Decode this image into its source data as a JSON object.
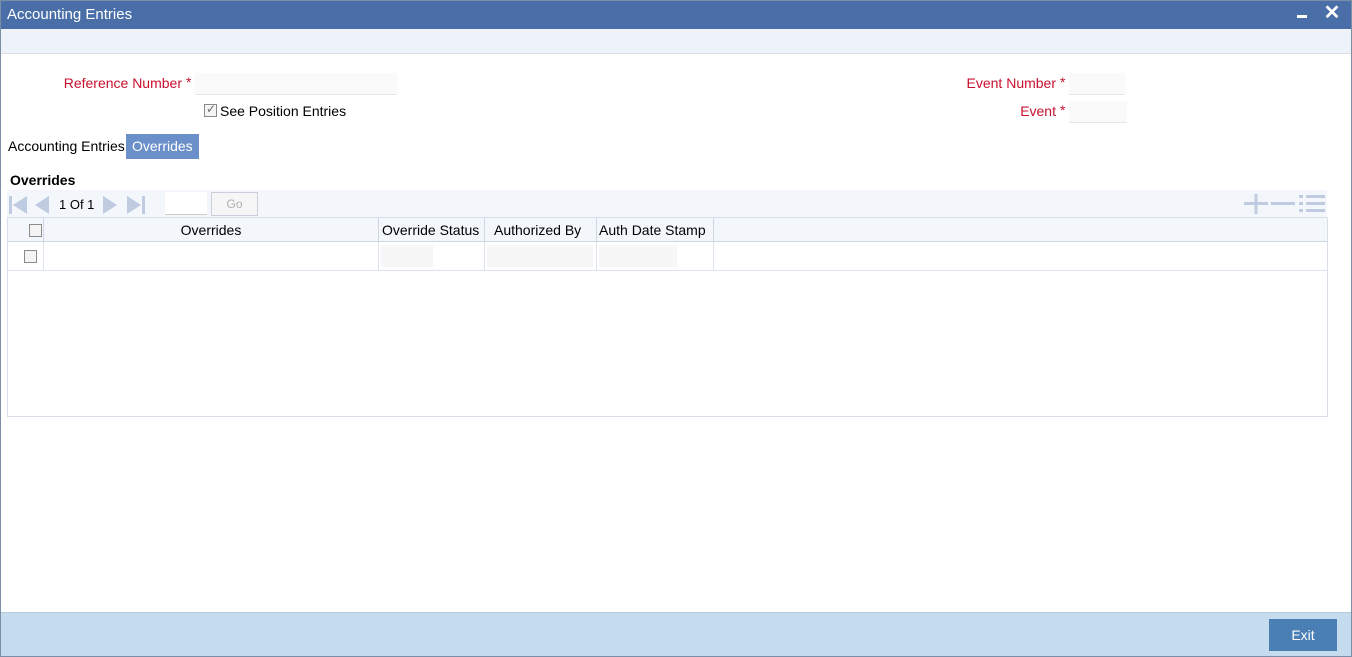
{
  "window": {
    "title": "Accounting Entries"
  },
  "form": {
    "reference_number_label": "Reference Number",
    "reference_number_value": "",
    "see_position_entries_label": "See Position Entries",
    "see_position_entries_checked": true,
    "event_number_label": "Event Number",
    "event_number_value": "",
    "event_label": "Event",
    "event_value": "",
    "required_marker": "*"
  },
  "tabs": [
    {
      "label": "Accounting Entries",
      "active": false
    },
    {
      "label": "Overrides",
      "active": true
    }
  ],
  "overrides": {
    "section_title": "Overrides",
    "pagination": {
      "text": "1 Of 1",
      "go_label": "Go"
    },
    "columns": [
      "Overrides",
      "Override Status",
      "Authorized By",
      "Auth Date Stamp"
    ],
    "rows": [
      {
        "overrides": "",
        "override_status": "",
        "authorized_by": "",
        "auth_date_stamp": ""
      }
    ]
  },
  "footer": {
    "exit_label": "Exit"
  },
  "colors": {
    "titlebar": "#4a6fa8",
    "required": "#c8102e",
    "active_tab": "#6b8fc9",
    "footer": "#c5dbee",
    "exit_button": "#4a7fb5"
  },
  "icons": [
    "minimize-icon",
    "close-icon",
    "first-page-icon",
    "previous-page-icon",
    "next-page-icon",
    "last-page-icon",
    "add-row-icon",
    "delete-row-icon",
    "single-view-icon"
  ]
}
